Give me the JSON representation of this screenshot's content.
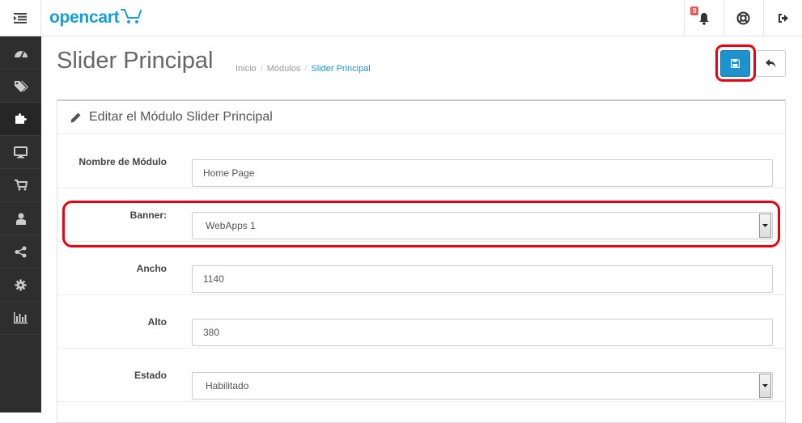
{
  "header": {
    "logo_text": "opencart",
    "notifications_count": "0"
  },
  "sidebar": {
    "items": [
      {
        "icon": "dashboard-icon"
      },
      {
        "icon": "tags-icon"
      },
      {
        "icon": "puzzle-icon"
      },
      {
        "icon": "desktop-icon"
      },
      {
        "icon": "cart-icon"
      },
      {
        "icon": "user-icon"
      },
      {
        "icon": "share-icon"
      },
      {
        "icon": "cog-icon"
      },
      {
        "icon": "bar-chart-icon"
      }
    ]
  },
  "page": {
    "title": "Slider Principal",
    "breadcrumb": [
      "Inicio",
      "Módulos",
      "Slider Principal"
    ]
  },
  "panel": {
    "heading": "Editar el Módulo Slider Principal"
  },
  "form": {
    "name": {
      "label": "Nombre de Módulo",
      "value": "Home Page"
    },
    "banner": {
      "label": "Banner:",
      "value": "WebApps 1"
    },
    "width": {
      "label": "Ancho",
      "value": "1140"
    },
    "height": {
      "label": "Alto",
      "value": "380"
    },
    "status": {
      "label": "Estado",
      "value": "Habilitado"
    }
  },
  "colors": {
    "accent": "#1e91cf",
    "highlight": "#e60012",
    "sidebar": "#2e2e2e"
  }
}
